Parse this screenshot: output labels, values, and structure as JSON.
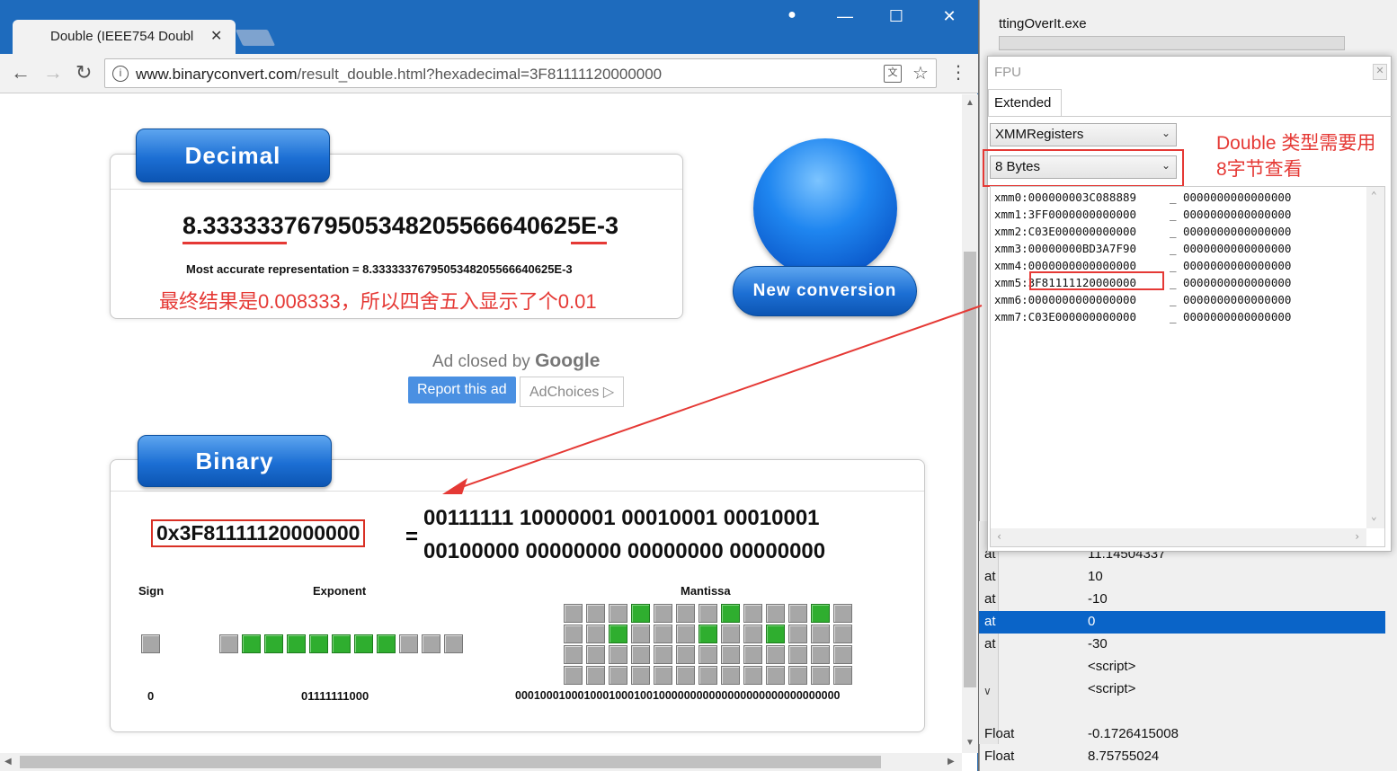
{
  "browser": {
    "tab_title": "Double (IEEE754 Doubl",
    "url_domain": "www.binaryconvert.com",
    "url_path": "/result_double.html?hexadecimal=3F81111120000000"
  },
  "decimal": {
    "header": "Decimal",
    "value": "8.3333337679505348205566640625E-3",
    "most_accurate": "Most accurate representation = 8.3333337679505348205566640625E-3",
    "note": "最终结果是0.008333，所以四舍五入显示了个0.01"
  },
  "new_conversion_label": "New conversion",
  "ad": {
    "closed_by": "Ad closed by",
    "google": "Google",
    "report": "Report this ad",
    "adchoices": "AdChoices ▷"
  },
  "binary": {
    "header": "Binary",
    "hex": "0x3F81111120000000",
    "equals": "=",
    "bits_line1": "00111111 10000001 00010001 00010001",
    "bits_line2": "00100000 00000000 00000000 00000000",
    "sign_label": "Sign",
    "exponent_label": "Exponent",
    "mantissa_label": "Mantissa",
    "sign_bits": "0",
    "exponent_bits": "01111111000",
    "mantissa_bits": "0001000100010001000100100000000000000000000000000000"
  },
  "debugger": {
    "window_title": "ttingOverIt.exe",
    "fpu_title": "FPU",
    "tab": "Extended",
    "combo1": "XMMRegisters",
    "combo2": "8 Bytes",
    "note_line1": "Double 类型需要用",
    "note_line2": "8字节查看",
    "sep": "_",
    "registers": [
      {
        "name": "xmm0:",
        "hi": "000000003C088889",
        "lo": "0000000000000000"
      },
      {
        "name": "xmm1:",
        "hi": "3FF0000000000000",
        "lo": "0000000000000000"
      },
      {
        "name": "xmm2:",
        "hi": "C03E000000000000",
        "lo": "0000000000000000"
      },
      {
        "name": "xmm3:",
        "hi": "00000000BD3A7F90",
        "lo": "0000000000000000"
      },
      {
        "name": "xmm4:",
        "hi": "0000000000000000",
        "lo": "0000000000000000"
      },
      {
        "name": "xmm5:",
        "hi": "3F81111120000000",
        "lo": "0000000000000000"
      },
      {
        "name": "xmm6:",
        "hi": "0000000000000000",
        "lo": "0000000000000000"
      },
      {
        "name": "xmm7:",
        "hi": "C03E000000000000",
        "lo": "0000000000000000"
      }
    ],
    "rows": [
      {
        "k": "at",
        "v": "11.14504337"
      },
      {
        "k": "at",
        "v": "10"
      },
      {
        "k": "at",
        "v": "-10"
      },
      {
        "k": "at",
        "v": "0"
      },
      {
        "k": "at",
        "v": "-30"
      },
      {
        "k": "",
        "v": "<script>"
      },
      {
        "k": "",
        "v": "<script>"
      },
      {
        "k": "",
        "v": ""
      },
      {
        "k": "Float",
        "v": "-0.1726415008"
      },
      {
        "k": "Float",
        "v": "8.75755024"
      }
    ]
  }
}
